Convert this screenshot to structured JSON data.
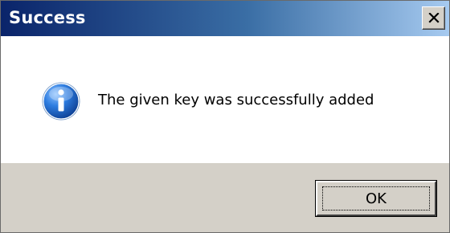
{
  "dialog": {
    "title": "Success",
    "close_icon": "close-icon",
    "icon": "info-icon",
    "message": "The given key was successfully added",
    "ok_label": "OK"
  },
  "colors": {
    "titlebar_start": "#0a246a",
    "titlebar_end": "#a6caf0",
    "face": "#d4d0c8",
    "info_icon": "#1f5fbf"
  }
}
